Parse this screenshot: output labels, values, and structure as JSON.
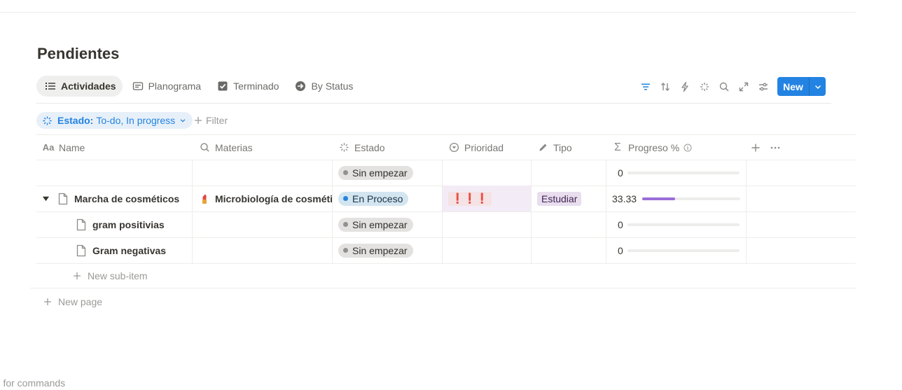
{
  "page": {
    "title": "Pendientes",
    "command_hint": "/' for commands"
  },
  "tabs": [
    {
      "label": "Actividades",
      "icon": "list-icon",
      "active": true
    },
    {
      "label": "Planograma",
      "icon": "board-icon",
      "active": false
    },
    {
      "label": "Terminado",
      "icon": "checkbox-icon",
      "active": false
    },
    {
      "label": "By Status",
      "icon": "arrow-circle-icon",
      "active": false
    }
  ],
  "toolbar": {
    "icons": [
      "filter-icon",
      "sort-icon",
      "automation-icon",
      "ai-sparkle-icon",
      "search-icon",
      "expand-icon",
      "settings-icon"
    ],
    "new_label": "New"
  },
  "filter": {
    "property": "Estado:",
    "value": "To-do, In progress",
    "add_label": "Filter"
  },
  "columns": [
    {
      "label": "Name",
      "icon": "text-aa-icon"
    },
    {
      "label": "Materias",
      "icon": "search-icon"
    },
    {
      "label": "Estado",
      "icon": "status-icon"
    },
    {
      "label": "Prioridad",
      "icon": "select-icon"
    },
    {
      "label": "Tipo",
      "icon": "pencil-icon"
    },
    {
      "label": "Progreso %",
      "icon": "sigma-icon"
    }
  ],
  "rows": [
    {
      "name": "",
      "materia": "",
      "estado": "Sin empezar",
      "prioridad": "",
      "tipo": "",
      "progress": "0",
      "progress_fraction": 0
    },
    {
      "name": "Marcha de cosméticos",
      "materia": "Microbiología de cosmético",
      "estado": "En Proceso",
      "prioridad": "❗❗❗",
      "tipo": "Estudiar",
      "progress": "33.33",
      "progress_fraction": 0.3333
    },
    {
      "name": "gram positivias",
      "materia": "",
      "estado": "Sin empezar",
      "prioridad": "",
      "tipo": "",
      "progress": "0",
      "progress_fraction": 0
    },
    {
      "name": "Gram negativas",
      "materia": "",
      "estado": "Sin empezar",
      "prioridad": "",
      "tipo": "",
      "progress": "0",
      "progress_fraction": 0
    }
  ],
  "actions": {
    "new_sub_item": "New sub-item",
    "new_page": "New page"
  },
  "colors": {
    "accent": "#2383e2",
    "progress": "#9a6dd7",
    "priority_bg": "#f4e2e4",
    "tag_purple_bg": "#e8deee"
  }
}
